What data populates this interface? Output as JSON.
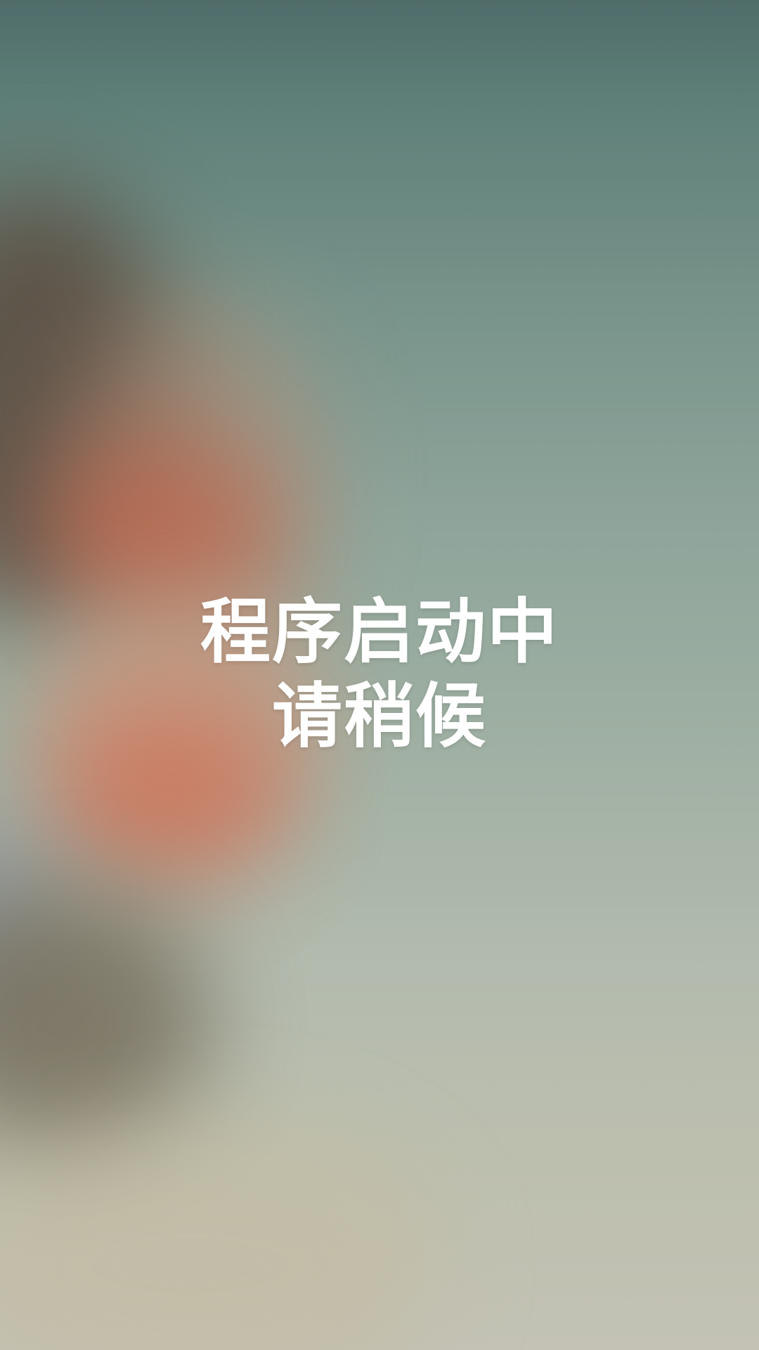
{
  "splash": {
    "line1": "程序启动中",
    "line2": "请稍候"
  },
  "colors": {
    "text": "#ffffff",
    "background_top": "#4f6c6a",
    "background_bottom": "#c3c2b5",
    "accent_red": "#cf7358"
  }
}
